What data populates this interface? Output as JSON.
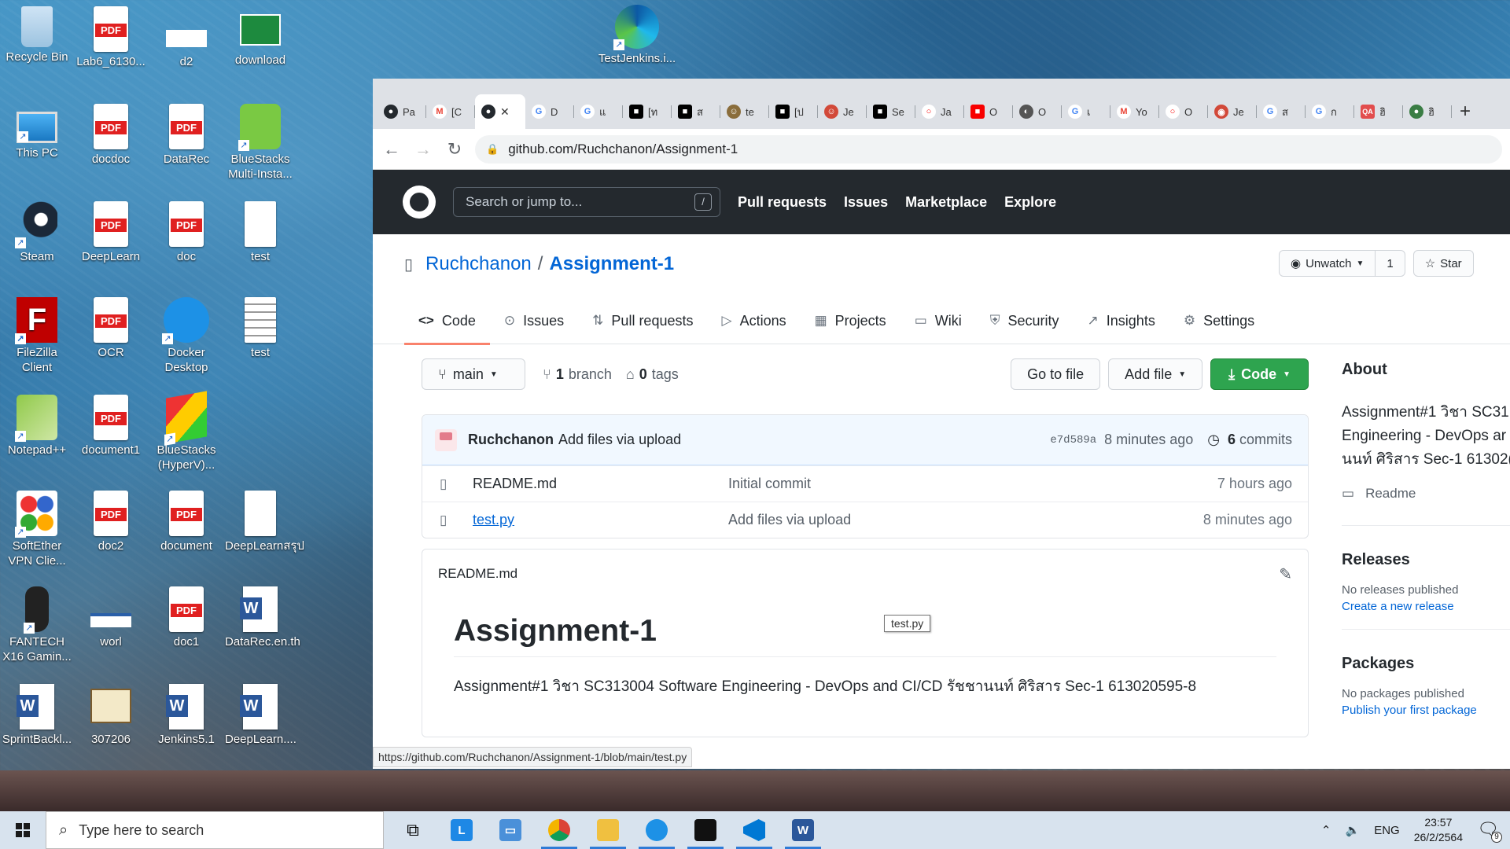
{
  "desktop": {
    "icons": [
      {
        "label": "Recycle Bin"
      },
      {
        "label": "Lab6_6130..."
      },
      {
        "label": "d2"
      },
      {
        "label": "download"
      },
      {
        "label": "This PC"
      },
      {
        "label": "docdoc"
      },
      {
        "label": "DataRec"
      },
      {
        "label": "BlueStacks Multi-Insta..."
      },
      {
        "label": "Steam"
      },
      {
        "label": "DeepLearn"
      },
      {
        "label": "doc"
      },
      {
        "label": "test"
      },
      {
        "label": "FileZilla Client"
      },
      {
        "label": "OCR"
      },
      {
        "label": "Docker Desktop"
      },
      {
        "label": "test"
      },
      {
        "label": "Notepad++"
      },
      {
        "label": "document1"
      },
      {
        "label": "BlueStacks (HyperV)..."
      },
      {
        "label": "SoftEther VPN Clie..."
      },
      {
        "label": "doc2"
      },
      {
        "label": "document"
      },
      {
        "label": "DeepLearnสรุป"
      },
      {
        "label": "FANTECH X16 Gamin..."
      },
      {
        "label": "worl"
      },
      {
        "label": "doc1"
      },
      {
        "label": "DataRec.en.th"
      },
      {
        "label": "SprintBackl..."
      },
      {
        "label": "307206"
      },
      {
        "label": "Jenkins5.1"
      },
      {
        "label": "DeepLearn...."
      },
      {
        "label": "TestJenkins.i..."
      }
    ]
  },
  "browser": {
    "tabs": [
      {
        "text": "Pa",
        "color": "#24292e",
        "glyph": "●"
      },
      {
        "text": "[C",
        "color": "#ea4335",
        "glyph": "M"
      },
      {
        "text": "",
        "color": "#24292e",
        "glyph": "●"
      },
      {
        "text": "D",
        "color": "#4285f4",
        "glyph": "G"
      },
      {
        "text": "แ",
        "color": "#4285f4",
        "glyph": "G"
      },
      {
        "text": "[ท",
        "color": "#000000",
        "glyph": "■"
      },
      {
        "text": "ส",
        "color": "#000000",
        "glyph": "■"
      },
      {
        "text": "te",
        "color": "#8a6d3b",
        "glyph": "☺"
      },
      {
        "text": "[ป",
        "color": "#000000",
        "glyph": "■"
      },
      {
        "text": "Je",
        "color": "#d24939",
        "glyph": "☺"
      },
      {
        "text": "Se",
        "color": "#000000",
        "glyph": "■"
      },
      {
        "text": "Ja",
        "color": "#f80000",
        "glyph": "○"
      },
      {
        "text": "O",
        "color": "#f80000",
        "glyph": "■"
      },
      {
        "text": "O",
        "color": "#555555",
        "glyph": "◐"
      },
      {
        "text": "เ",
        "color": "#4285f4",
        "glyph": "G"
      },
      {
        "text": "Yo",
        "color": "#ea4335",
        "glyph": "M"
      },
      {
        "text": "O",
        "color": "#f80000",
        "glyph": "○"
      },
      {
        "text": "Je",
        "color": "#d24939",
        "glyph": "◉"
      },
      {
        "text": "ส",
        "color": "#4285f4",
        "glyph": "G"
      },
      {
        "text": "ก",
        "color": "#4285f4",
        "glyph": "G"
      },
      {
        "text": "ฮิ",
        "color": "#e24d4d",
        "glyph": "QA"
      },
      {
        "text": "ฮิ",
        "color": "#3a7d44",
        "glyph": "●"
      }
    ],
    "close_glyph": "✕",
    "new_tab": "+",
    "url": "github.com/Ruchchanon/Assignment-1",
    "status_url": "https://github.com/Ruchchanon/Assignment-1/blob/main/test.py"
  },
  "github": {
    "search_placeholder": "Search or jump to...",
    "search_key": "/",
    "nav": [
      "Pull requests",
      "Issues",
      "Marketplace",
      "Explore"
    ],
    "owner": "Ruchchanon",
    "separator": "/",
    "repo": "Assignment-1",
    "watch_label": "Unwatch",
    "watch_count": "1",
    "star_label": "Star",
    "tabs": [
      {
        "label": "Code",
        "icon": "<>"
      },
      {
        "label": "Issues",
        "icon": "⊙"
      },
      {
        "label": "Pull requests",
        "icon": "⇅"
      },
      {
        "label": "Actions",
        "icon": "▷"
      },
      {
        "label": "Projects",
        "icon": "▦"
      },
      {
        "label": "Wiki",
        "icon": "▭"
      },
      {
        "label": "Security",
        "icon": "⛨"
      },
      {
        "label": "Insights",
        "icon": "↗"
      },
      {
        "label": "Settings",
        "icon": "⚙"
      }
    ],
    "branch": "main",
    "branch_count": "1",
    "branch_label": "branch",
    "tag_count": "0",
    "tag_label": "tags",
    "go_to_file": "Go to file",
    "add_file": "Add file",
    "code_button": "Code",
    "commit": {
      "author": "Ruchchanon",
      "message": "Add files via upload",
      "sha": "e7d589a",
      "age": "8 minutes ago",
      "count": "6",
      "count_label": "commits"
    },
    "files": [
      {
        "name": "README.md",
        "message": "Initial commit",
        "age": "7 hours ago"
      },
      {
        "name": "test.py",
        "message": "Add files via upload",
        "age": "8 minutes ago"
      }
    ],
    "tooltip": "test.py",
    "readme": {
      "filename": "README.md",
      "heading": "Assignment-1",
      "body": "Assignment#1 วิชา SC313004 Software Engineering - DevOps and CI/CD รัชชานนท์ ศิริสาร Sec-1 613020595-8"
    },
    "about": {
      "title": "About",
      "desc_lines": [
        "Assignment#1 วิชา SC31",
        "Engineering - DevOps ar",
        "นนท์ ศิริสาร Sec-1 61302("
      ],
      "readme_link": "Readme"
    },
    "releases": {
      "title": "Releases",
      "none": "No releases published",
      "link": "Create a new release"
    },
    "packages": {
      "title": "Packages",
      "none": "No packages published",
      "link": "Publish your first package"
    }
  },
  "taskbar": {
    "search_placeholder": "Type here to search",
    "language": "ENG",
    "time": "23:57",
    "date": "26/2/2564",
    "notification_count": "9"
  }
}
